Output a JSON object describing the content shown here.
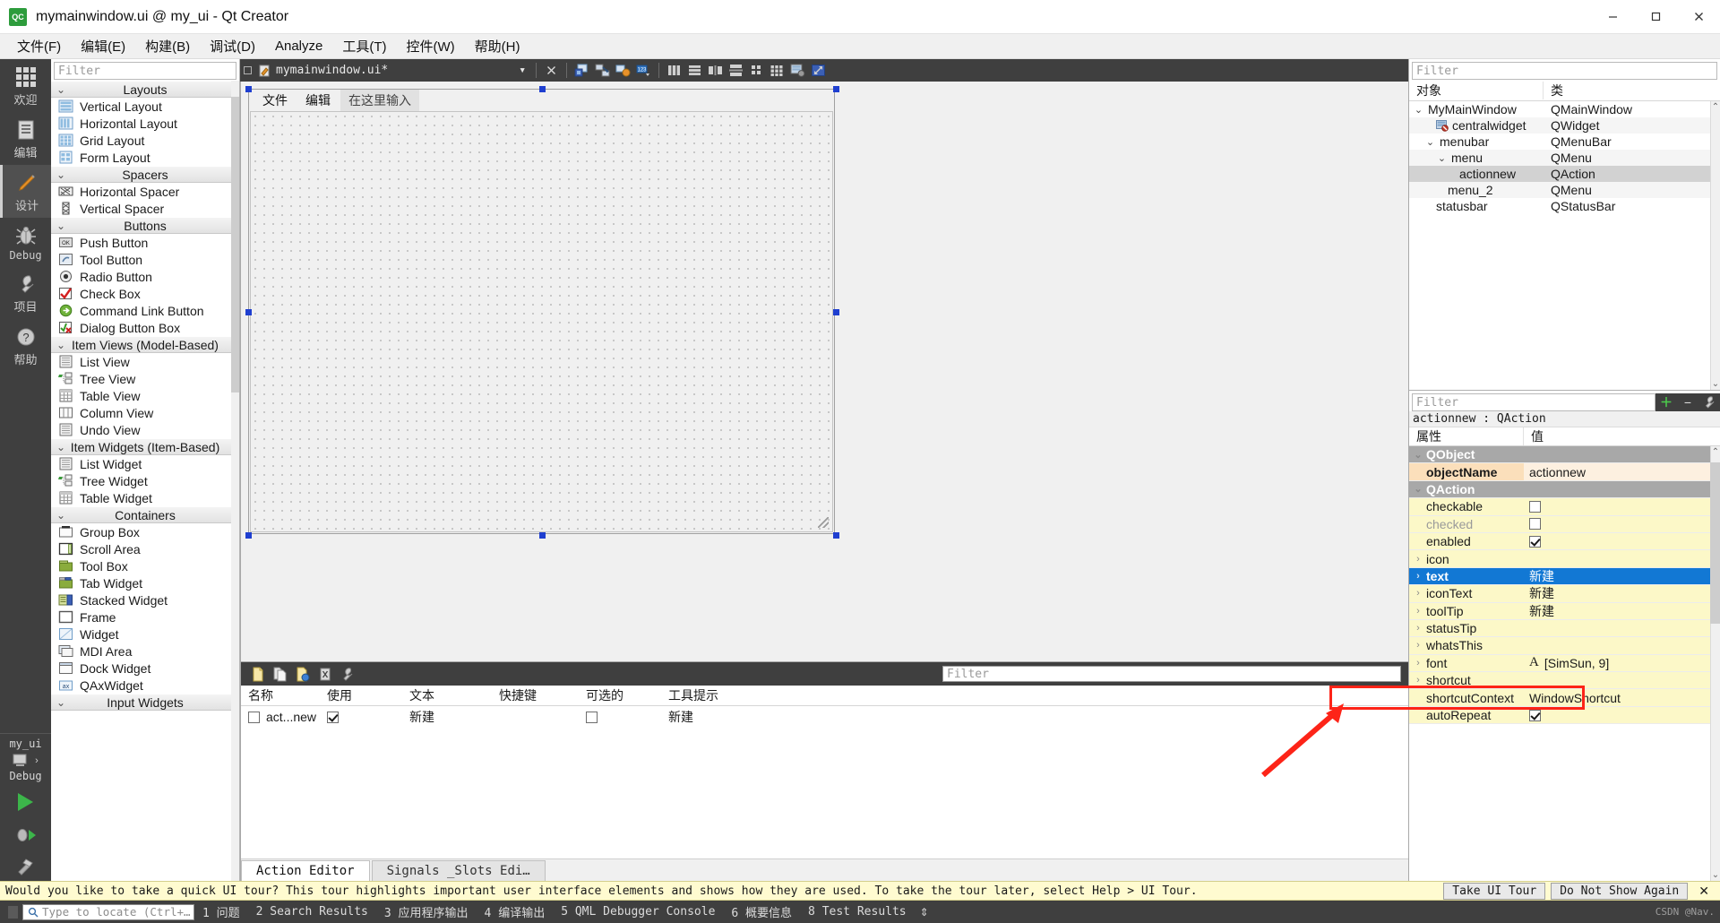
{
  "window": {
    "title": "mymainwindow.ui @ my_ui - Qt Creator",
    "logo_text": "QC",
    "minimize": "—",
    "maximize": "▢",
    "close": "✕"
  },
  "menubar": [
    {
      "label": "文件(F)",
      "name": "menu-file"
    },
    {
      "label": "编辑(E)",
      "name": "menu-edit"
    },
    {
      "label": "构建(B)",
      "name": "menu-build"
    },
    {
      "label": "调试(D)",
      "name": "menu-debug"
    },
    {
      "label": "Analyze",
      "name": "menu-analyze"
    },
    {
      "label": "工具(T)",
      "name": "menu-tools"
    },
    {
      "label": "控件(W)",
      "name": "menu-window"
    },
    {
      "label": "帮助(H)",
      "name": "menu-help"
    }
  ],
  "modebar": {
    "modes": [
      {
        "label": "欢迎",
        "icon": "grid-icon",
        "active": false
      },
      {
        "label": "编辑",
        "icon": "document-icon",
        "active": false
      },
      {
        "label": "设计",
        "icon": "pencil-icon",
        "active": true
      },
      {
        "label": "Debug",
        "icon": "bug-icon",
        "active": false
      },
      {
        "label": "项目",
        "icon": "wrench-icon",
        "active": false
      },
      {
        "label": "帮助",
        "icon": "question-icon",
        "active": false
      }
    ],
    "kit_name": "my_ui",
    "kit_config": "Debug",
    "run_label": "run-button",
    "debug_label": "debug-button",
    "build_label": "build-button"
  },
  "widget_box": {
    "filter_placeholder": "Filter",
    "groups": [
      {
        "title": "Layouts",
        "items": [
          {
            "label": "Vertical Layout",
            "icon": "vertical-layout-icon"
          },
          {
            "label": "Horizontal Layout",
            "icon": "horizontal-layout-icon"
          },
          {
            "label": "Grid Layout",
            "icon": "grid-layout-icon"
          },
          {
            "label": "Form Layout",
            "icon": "form-layout-icon"
          }
        ]
      },
      {
        "title": "Spacers",
        "items": [
          {
            "label": "Horizontal Spacer",
            "icon": "horizontal-spacer-icon"
          },
          {
            "label": "Vertical Spacer",
            "icon": "vertical-spacer-icon"
          }
        ]
      },
      {
        "title": "Buttons",
        "items": [
          {
            "label": "Push Button",
            "icon": "push-button-icon"
          },
          {
            "label": "Tool Button",
            "icon": "tool-button-icon"
          },
          {
            "label": "Radio Button",
            "icon": "radio-button-icon"
          },
          {
            "label": "Check Box",
            "icon": "check-box-icon"
          },
          {
            "label": "Command Link Button",
            "icon": "command-link-icon"
          },
          {
            "label": "Dialog Button Box",
            "icon": "dialog-button-box-icon"
          }
        ]
      },
      {
        "title": "Item Views (Model-Based)",
        "items": [
          {
            "label": "List View",
            "icon": "list-view-icon"
          },
          {
            "label": "Tree View",
            "icon": "tree-view-icon"
          },
          {
            "label": "Table View",
            "icon": "table-view-icon"
          },
          {
            "label": "Column View",
            "icon": "column-view-icon"
          },
          {
            "label": "Undo View",
            "icon": "undo-view-icon"
          }
        ]
      },
      {
        "title": "Item Widgets (Item-Based)",
        "items": [
          {
            "label": "List Widget",
            "icon": "list-widget-icon"
          },
          {
            "label": "Tree Widget",
            "icon": "tree-widget-icon"
          },
          {
            "label": "Table Widget",
            "icon": "table-widget-icon"
          }
        ]
      },
      {
        "title": "Containers",
        "items": [
          {
            "label": "Group Box",
            "icon": "group-box-icon"
          },
          {
            "label": "Scroll Area",
            "icon": "scroll-area-icon"
          },
          {
            "label": "Tool Box",
            "icon": "tool-box-icon"
          },
          {
            "label": "Tab Widget",
            "icon": "tab-widget-icon"
          },
          {
            "label": "Stacked Widget",
            "icon": "stacked-widget-icon"
          },
          {
            "label": "Frame",
            "icon": "frame-icon"
          },
          {
            "label": "Widget",
            "icon": "widget-icon"
          },
          {
            "label": "MDI Area",
            "icon": "mdi-area-icon"
          },
          {
            "label": "Dock Widget",
            "icon": "dock-widget-icon"
          },
          {
            "label": "QAxWidget",
            "icon": "qaxwidget-icon"
          }
        ]
      },
      {
        "title": "Input Widgets",
        "items": []
      }
    ]
  },
  "doc_toolbar": {
    "filename": "mymainwindow.ui*",
    "close_icon": "✕",
    "dropdown_icon": "▾",
    "tools": [
      "edit-widgets-icon",
      "edit-signals-slots-icon",
      "edit-buddies-icon",
      "edit-tab-order-icon",
      "layout-horizontally-icon",
      "layout-vertically-icon",
      "layout-splitter-h-icon",
      "layout-splitter-v-icon",
      "layout-form-icon",
      "layout-grid-icon",
      "break-layout-icon",
      "adjust-size-icon"
    ]
  },
  "form": {
    "menus": [
      "文件",
      "编辑"
    ],
    "placeholder": "在这里输入"
  },
  "action_editor": {
    "toolbar_icons": [
      "new-action-icon",
      "copy-action-icon",
      "paste-action-icon",
      "delete-action-icon",
      "configure-icon"
    ],
    "filter_placeholder": "Filter",
    "columns": [
      "名称",
      "使用",
      "文本",
      "快捷键",
      "可选的",
      "工具提示"
    ],
    "rows": [
      {
        "name": "act...new",
        "used": true,
        "text": "新建",
        "shortcut": "",
        "checkable": false,
        "tooltip": "新建"
      }
    ],
    "tabs": [
      {
        "label": "Action Editor",
        "active": true
      },
      {
        "label": "Signals _Slots Edi…",
        "active": false
      }
    ]
  },
  "object_inspector": {
    "filter_placeholder": "Filter",
    "columns": [
      "对象",
      "类"
    ],
    "rows": [
      {
        "name": "MyMainWindow",
        "cls": "QMainWindow",
        "depth": 0,
        "twisty": "⌄",
        "icon": "",
        "selected": false
      },
      {
        "name": "centralwidget",
        "cls": "QWidget",
        "depth": 2,
        "twisty": "",
        "icon": "no-layout-icon",
        "selected": false
      },
      {
        "name": "menubar",
        "cls": "QMenuBar",
        "depth": 1,
        "twisty": "⌄",
        "icon": "",
        "selected": false
      },
      {
        "name": "menu",
        "cls": "QMenu",
        "depth": 2,
        "twisty": "⌄",
        "icon": "",
        "selected": false
      },
      {
        "name": "actionnew",
        "cls": "QAction",
        "depth": 3,
        "twisty": "",
        "icon": "",
        "selected": true
      },
      {
        "name": "menu_2",
        "cls": "QMenu",
        "depth": 2,
        "twisty": "",
        "icon": "",
        "selected": false
      },
      {
        "name": "statusbar",
        "cls": "QStatusBar",
        "depth": 1,
        "twisty": "",
        "icon": "",
        "selected": false
      }
    ]
  },
  "property_editor": {
    "filter_placeholder": "Filter",
    "buttons": [
      "add-icon",
      "remove-icon",
      "configure-icon"
    ],
    "object_line": "actionnew : QAction",
    "columns": [
      "属性",
      "值"
    ],
    "rows": [
      {
        "kind": "group",
        "name": "QObject",
        "value": "",
        "twisty": "⌄"
      },
      {
        "kind": "objectname",
        "name": "objectName",
        "value": "actionnew",
        "twisty": ""
      },
      {
        "kind": "group",
        "name": "QAction",
        "value": "",
        "twisty": "⌄"
      },
      {
        "kind": "bool",
        "name": "checkable",
        "value": "",
        "checked": false,
        "twisty": ""
      },
      {
        "kind": "bool",
        "name": "checked",
        "value": "",
        "checked": false,
        "twisty": "",
        "disabled": true
      },
      {
        "kind": "bool",
        "name": "enabled",
        "value": "",
        "checked": true,
        "twisty": ""
      },
      {
        "kind": "normal",
        "name": "icon",
        "value": "",
        "twisty": "›"
      },
      {
        "kind": "selected",
        "name": "text",
        "value": "新建",
        "twisty": "›"
      },
      {
        "kind": "normal",
        "name": "iconText",
        "value": "新建",
        "twisty": "›"
      },
      {
        "kind": "normal",
        "name": "toolTip",
        "value": "新建",
        "twisty": "›"
      },
      {
        "kind": "normal",
        "name": "statusTip",
        "value": "",
        "twisty": "›"
      },
      {
        "kind": "normal",
        "name": "whatsThis",
        "value": "",
        "twisty": "›"
      },
      {
        "kind": "font",
        "name": "font",
        "value": "[SimSun, 9]",
        "twisty": "›",
        "prefix": "A"
      },
      {
        "kind": "normal",
        "name": "shortcut",
        "value": "",
        "twisty": "›"
      },
      {
        "kind": "normal",
        "name": "shortcutContext",
        "value": "WindowShortcut",
        "twisty": ""
      },
      {
        "kind": "bool",
        "name": "autoRepeat",
        "value": "",
        "checked": true,
        "twisty": ""
      }
    ]
  },
  "tour_banner": {
    "message": "Would you like to take a quick UI tour? This tour highlights important user interface elements and shows how they are used. To take the tour later, select Help > UI Tour.",
    "take_tour": "Take UI Tour",
    "do_not_show": "Do Not Show Again",
    "close": "✕"
  },
  "statusbar": {
    "locate_placeholder": "Type to locate (Ctrl+…",
    "search_icon": "search-icon",
    "items": [
      "1 问题",
      "2 Search Results",
      "3 应用程序输出",
      "4 编译输出",
      "5 QML Debugger Console",
      "6 概要信息",
      "8 Test Results"
    ],
    "updown": "⇕",
    "watermark": "CSDN @Nav."
  },
  "colors": {
    "accent_blue": "#1278d4",
    "annotation_red": "#fd2418",
    "property_yellow": "#fcf8c8",
    "dark_chrome": "#3f3f3f"
  }
}
